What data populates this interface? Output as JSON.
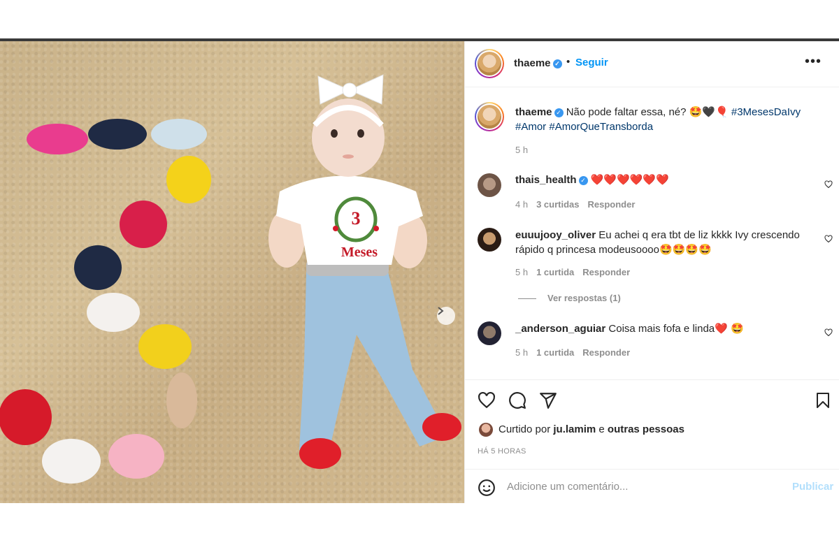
{
  "post": {
    "username": "thaeme",
    "follow_label": "Seguir",
    "separator": "•",
    "more_label": "•••"
  },
  "caption": {
    "username": "thaeme",
    "text": "Não pode faltar essa, né? 🤩🖤🎈",
    "hashtags": [
      "#3MesesDaIvy",
      "#Amor",
      "#AmorQueTransborda"
    ],
    "time": "5 h"
  },
  "comments": [
    {
      "username": "thais_health",
      "verified": true,
      "text": "❤️❤️❤️❤️❤️❤️",
      "time": "4 h",
      "likes": "3 curtidas",
      "reply": "Responder"
    },
    {
      "username": "euuujooy_oliver",
      "verified": false,
      "text": "Eu achei q era tbt de liz kkkk Ivy crescendo",
      "text2": "rápido q princesa modeusoooo🤩🤩🤩🤩",
      "time": "5 h",
      "likes": "1 curtida",
      "reply": "Responder",
      "view_replies": "Ver respostas (1)"
    },
    {
      "username": "_anderson_aguiar",
      "verified": false,
      "text": "Coisa mais fofa e linda❤️ 🤩",
      "time": "5 h",
      "likes": "1 curtida",
      "reply": "Responder"
    }
  ],
  "likes_line": {
    "prefix": "Curtido por",
    "user": "ju.lamim",
    "conj": "e",
    "others": "outras pessoas"
  },
  "timestamp": "HÁ 5 HORAS",
  "comment_box": {
    "placeholder": "Adicione um comentário...",
    "publish_label": "Publicar"
  },
  "photo": {
    "onesie_text": "Meses",
    "onesie_number": "3",
    "carousel_index": 1,
    "carousel_total": 2
  }
}
